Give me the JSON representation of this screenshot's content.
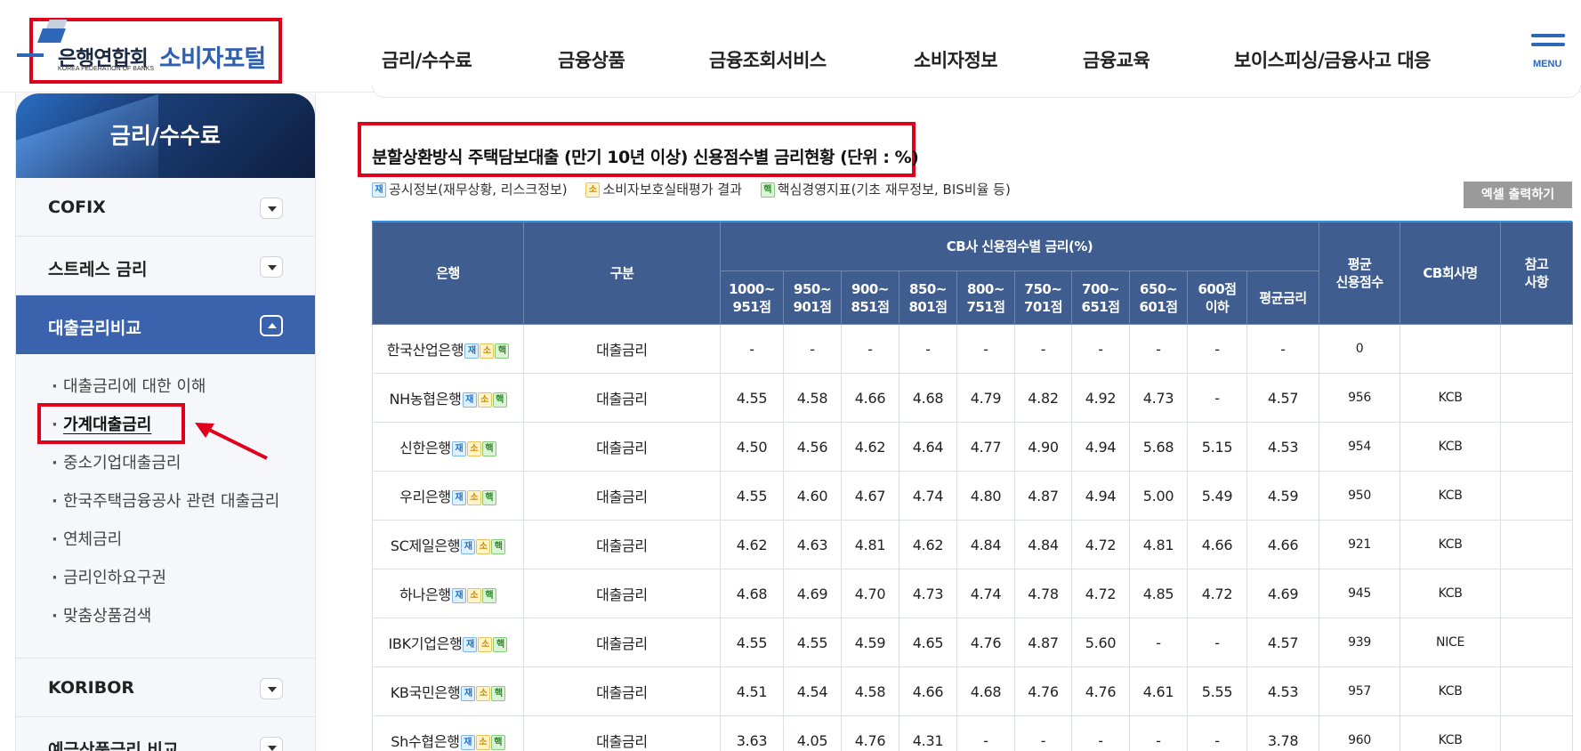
{
  "header": {
    "logo_ko": "은행연합회",
    "logo_en": "KOREA FEDERATION OF BANKS",
    "logo_portal": "소비자포털",
    "nav": [
      "금리/수수료",
      "금융상품",
      "금융조회서비스",
      "소비자정보",
      "금융교육",
      "보이스피싱/금융사고 대응"
    ],
    "menu_label": "MENU"
  },
  "sidebar": {
    "title": "금리/수수료",
    "items": [
      {
        "label": "COFIX"
      },
      {
        "label": "스트레스 금리"
      },
      {
        "label": "대출금리비교"
      },
      {
        "label": "KORIBOR"
      },
      {
        "label": "예금상품금리 비교"
      }
    ],
    "subs": [
      "대출금리에 대한 이해",
      "가계대출금리",
      "중소기업대출금리",
      "한국주택금융공사 관련 대출금리",
      "연체금리",
      "금리인하요구권",
      "맞춤상품검색"
    ]
  },
  "main": {
    "title": "분할상환방식 주택담보대출 (만기 10년 이상) 신용점수별 금리현황 (단위 : %)",
    "legend": [
      {
        "badge": "재",
        "text": "공시정보(재무상황, 리스크정보)"
      },
      {
        "badge": "소",
        "text": "소비자보호실태평가 결과"
      },
      {
        "badge": "핵",
        "text": "핵심경영지표(기초 재무정보, BIS비율 등)"
      }
    ],
    "excel_button": "엑셀 출력하기",
    "table": {
      "head": {
        "bank": "은행",
        "type": "구분",
        "cb_group": "CB사 신용점수별 금리(%)",
        "avg_score_1": "평균",
        "avg_score_2": "신용점수",
        "cb_company": "CB회사명",
        "note_1": "참고",
        "note_2": "사항",
        "score_cols": [
          [
            "1000~",
            "951점"
          ],
          [
            "950~",
            "901점"
          ],
          [
            "900~",
            "851점"
          ],
          [
            "850~",
            "801점"
          ],
          [
            "800~",
            "751점"
          ],
          [
            "750~",
            "701점"
          ],
          [
            "700~",
            "651점"
          ],
          [
            "650~",
            "601점"
          ],
          [
            "600점",
            "이하"
          ],
          [
            "평균금리",
            ""
          ]
        ]
      },
      "rows": [
        {
          "bank": "한국산업은행",
          "type": "대출금리",
          "rates": [
            "-",
            "-",
            "-",
            "-",
            "-",
            "-",
            "-",
            "-",
            "-",
            "-"
          ],
          "avg_score": "0",
          "cb": ""
        },
        {
          "bank": "NH농협은행",
          "type": "대출금리",
          "rates": [
            "4.55",
            "4.58",
            "4.66",
            "4.68",
            "4.79",
            "4.82",
            "4.92",
            "4.73",
            "-",
            "4.57"
          ],
          "avg_score": "956",
          "cb": "KCB"
        },
        {
          "bank": "신한은행",
          "type": "대출금리",
          "rates": [
            "4.50",
            "4.56",
            "4.62",
            "4.64",
            "4.77",
            "4.90",
            "4.94",
            "5.68",
            "5.15",
            "4.53"
          ],
          "avg_score": "954",
          "cb": "KCB"
        },
        {
          "bank": "우리은행",
          "type": "대출금리",
          "rates": [
            "4.55",
            "4.60",
            "4.67",
            "4.74",
            "4.80",
            "4.87",
            "4.94",
            "5.00",
            "5.49",
            "4.59"
          ],
          "avg_score": "950",
          "cb": "KCB"
        },
        {
          "bank": "SC제일은행",
          "type": "대출금리",
          "rates": [
            "4.62",
            "4.63",
            "4.81",
            "4.62",
            "4.84",
            "4.84",
            "4.72",
            "4.81",
            "4.66",
            "4.66"
          ],
          "avg_score": "921",
          "cb": "KCB"
        },
        {
          "bank": "하나은행",
          "type": "대출금리",
          "rates": [
            "4.68",
            "4.69",
            "4.70",
            "4.73",
            "4.74",
            "4.78",
            "4.72",
            "4.85",
            "4.72",
            "4.69"
          ],
          "avg_score": "945",
          "cb": "KCB"
        },
        {
          "bank": "IBK기업은행",
          "type": "대출금리",
          "rates": [
            "4.55",
            "4.55",
            "4.59",
            "4.65",
            "4.76",
            "4.87",
            "5.60",
            "-",
            "-",
            "4.57"
          ],
          "avg_score": "939",
          "cb": "NICE"
        },
        {
          "bank": "KB국민은행",
          "type": "대출금리",
          "rates": [
            "4.51",
            "4.54",
            "4.58",
            "4.66",
            "4.68",
            "4.76",
            "4.76",
            "4.61",
            "5.55",
            "4.53"
          ],
          "avg_score": "957",
          "cb": "KCB"
        },
        {
          "bank": "Sh수협은행",
          "type": "대출금리",
          "rates": [
            "3.63",
            "4.05",
            "4.76",
            "4.31",
            "-",
            "-",
            "-",
            "-",
            "-",
            "3.78"
          ],
          "avg_score": "960",
          "cb": "KCB"
        }
      ]
    }
  },
  "colors": {
    "accent": "#3b63ad",
    "header_bg": "#3f5d8e",
    "highlight": "#e0001b"
  }
}
